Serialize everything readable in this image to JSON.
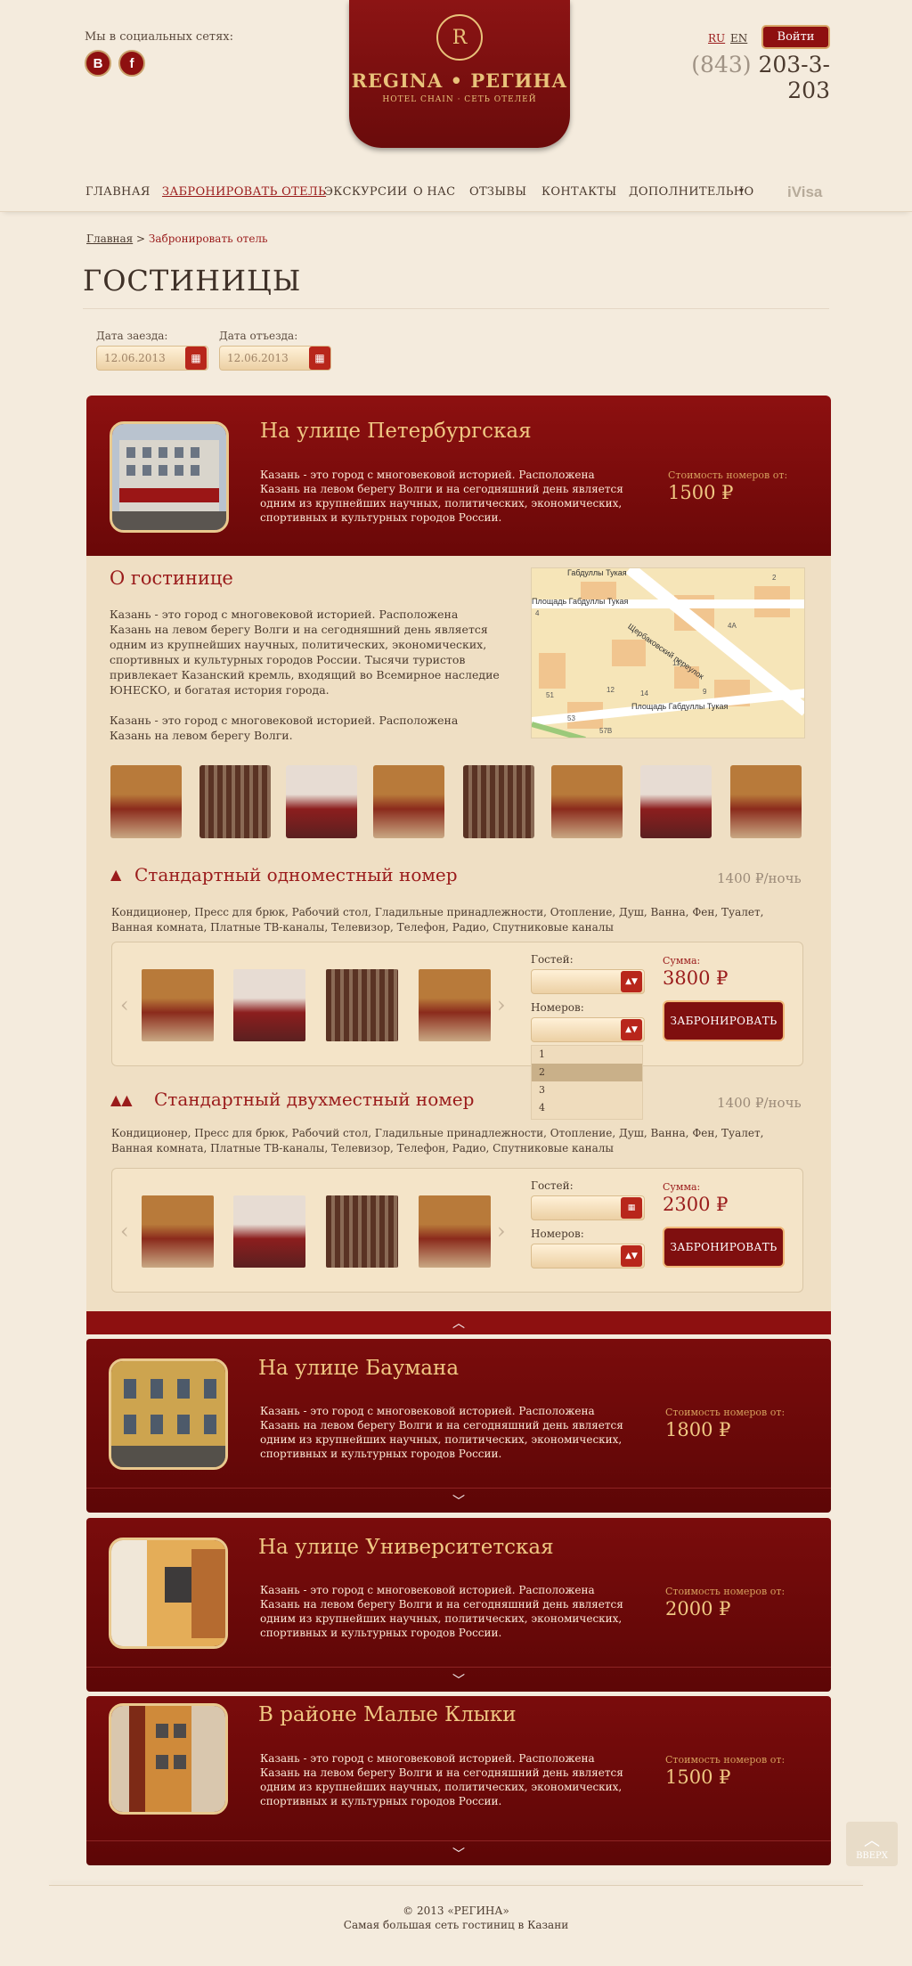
{
  "header": {
    "social_title": "Мы в социальных сетях:",
    "social": [
      "B",
      "f"
    ],
    "logo": {
      "name": "REGINA • РЕГИНА",
      "sub": "HOTEL CHAIN  ·  СЕТЬ ОТЕЛЕЙ",
      "emblem": "R"
    },
    "lang": [
      "RU",
      "EN"
    ],
    "login": "Войти",
    "phone_code": "(843)",
    "phone_number": "203-3-203"
  },
  "nav": {
    "items": [
      "ГЛАВНАЯ",
      "ЗАБРОНИРОВАТЬ ОТЕЛЬ",
      "ЭКСКУРСИИ",
      "О НАС",
      "ОТЗЫВЫ",
      "КОНТАКТЫ",
      "ДОПОЛНИТЕЛЬНО"
    ],
    "more_arrow": "▾",
    "visa": "iVisa"
  },
  "breadcrumb": {
    "home": "Главная",
    "sep": " > ",
    "current": "Забронировать отель"
  },
  "page_title": "ГОСТИНИЦЫ",
  "dates": {
    "checkin_label": "Дата заезда:",
    "checkin_value": "12.06.2013",
    "checkout_label": "Дата отъезда:",
    "checkout_value": "12.06.2013"
  },
  "hotel_main": {
    "name": "На улице Петербургская",
    "desc": "Казань - это город с многовековой историей. Расположена Казань на левом берегу Волги и на сегодняшний день является одним из крупнейших научных, политических, экономических, спортивных и культурных городов России.",
    "price_label": "Стоимость номеров от:",
    "price": "1500 ₽",
    "about_title": "О гостинице",
    "about_p1": "Казань - это город с многовековой историей. Расположена Казань на левом берегу Волги и на сегодняшний день является одним из крупнейших научных, политических, экономических, спортивных и культурных городов России. Тысячи туристов привлекает Казанский кремль, входящий во Всемирное наследие ЮНЕСКО, и богатая история города.",
    "about_p2": "Казань - это город с многовековой историей. Расположена Казань на левом берегу Волги.",
    "map_labels": {
      "street_top": "Габдуллы Тукая",
      "square_top": "Площадь Габдуллы Тукая",
      "lane": "Щербаковский переулок",
      "square_bottom": "Площадь Габдуллы Тукая",
      "numbers": [
        "4",
        "4А",
        "11",
        "51",
        "12",
        "14",
        "9",
        "53",
        "57В",
        "2"
      ]
    }
  },
  "rooms": [
    {
      "title": "Стандартный одноместный номер",
      "price": "1400 ₽/ночь",
      "amenities": "Кондиционер, Пресс для брюк, Рабочий стол, Гладильные принадлежности, Отопление, Душ, Ванна, Фен, Туалет, Ванная комната, Платные ТВ-каналы, Телевизор, Телефон, Радио, Спутниковые каналы",
      "guests_label": "Гостей:",
      "rooms_label": "Номеров:",
      "sum_label": "Сумма:",
      "sum": "3800 ₽",
      "book": "ЗАБРОНИРОВАТЬ",
      "dropdown": [
        "1",
        "2",
        "3",
        "4"
      ]
    },
    {
      "title": "Стандартный двухместный номер",
      "price": "1400 ₽/ночь",
      "amenities": "Кондиционер, Пресс для брюк, Рабочий стол, Гладильные принадлежности, Отопление, Душ, Ванна, Фен, Туалет, Ванная комната, Платные ТВ-каналы, Телевизор, Телефон, Радио, Спутниковые каналы",
      "guests_label": "Гостей:",
      "rooms_label": "Номеров:",
      "sum_label": "Сумма:",
      "sum": "2300 ₽",
      "book": "ЗАБРОНИРОВАТЬ"
    }
  ],
  "hotels": [
    {
      "name": "На улице Баумана",
      "desc": "Казань - это город с многовековой историей. Расположена Казань на левом берегу Волги и на сегодняшний день является одним из крупнейших научных, политических, экономических, спортивных и культурных городов России.",
      "price_label": "Стоимость номеров от:",
      "price": "1800 ₽"
    },
    {
      "name": "На улице Университетская",
      "desc": "Казань - это город с многовековой историей. Расположена Казань на левом берегу Волги и на сегодняшний день является одним из крупнейших научных, политических, экономических, спортивных и культурных городов России.",
      "price_label": "Стоимость номеров от:",
      "price": "2000 ₽"
    },
    {
      "name": "В районе Малые Клыки",
      "desc": "Казань - это город с многовековой историей. Расположена Казань на левом берегу Волги и на сегодняшний день является одним из крупнейших научных, политических, экономических, спортивных и культурных городов России.",
      "price_label": "Стоимость номеров от:",
      "price": "1500 ₽"
    }
  ],
  "to_top": "ВВЕРХ",
  "footer": {
    "copy": "© 2013 «РЕГИНА»",
    "tagline": "Самая большая сеть гостиниц в Казани"
  },
  "colors": {
    "accent": "#8d1010",
    "gold": "#f0c883",
    "bg": "#f4ebdd"
  }
}
